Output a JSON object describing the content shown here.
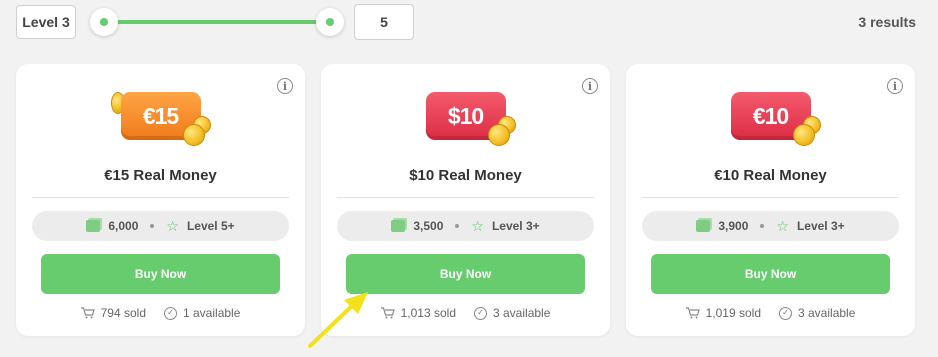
{
  "filter": {
    "level_label": "Level 3",
    "max_value": "5",
    "results_text": "3 results"
  },
  "colors": {
    "accent": "#66cc6e",
    "badge_orange": "#f58a23",
    "badge_red": "#e33a52"
  },
  "cards": [
    {
      "badge_text": "€15",
      "badge_color": "orange",
      "title": "€15 Real Money",
      "price": "6,000",
      "level": "Level 5+",
      "button_label": "Buy Now",
      "sold": "794 sold",
      "available": "1 available"
    },
    {
      "badge_text": "$10",
      "badge_color": "red",
      "title": "$10 Real Money",
      "price": "3,500",
      "level": "Level 3+",
      "button_label": "Buy Now",
      "sold": "1,013 sold",
      "available": "3 available"
    },
    {
      "badge_text": "€10",
      "badge_color": "red",
      "title": "€10 Real Money",
      "price": "3,900",
      "level": "Level 3+",
      "button_label": "Buy Now",
      "sold": "1,019 sold",
      "available": "3 available"
    }
  ],
  "icons": {
    "info": "info-icon",
    "cash": "cash-icon",
    "star": "star-icon",
    "cart": "cart-icon",
    "check": "check-circle-icon",
    "annotation": "arrow-annotation-icon"
  }
}
